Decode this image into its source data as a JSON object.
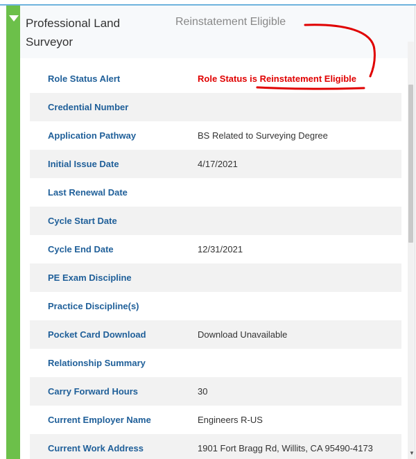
{
  "role": {
    "title": "Professional Land Surveyor",
    "status": "Reinstatement Eligible"
  },
  "rows": [
    {
      "label": "Role Status Alert",
      "value": "Role Status is Reinstatement Eligible"
    },
    {
      "label": "Credential Number",
      "value": ""
    },
    {
      "label": "Application Pathway",
      "value": "BS Related to Surveying Degree"
    },
    {
      "label": "Initial Issue Date",
      "value": "4/17/2021"
    },
    {
      "label": "Last Renewal Date",
      "value": ""
    },
    {
      "label": "Cycle Start Date",
      "value": ""
    },
    {
      "label": "Cycle End Date",
      "value": "12/31/2021"
    },
    {
      "label": "PE Exam Discipline",
      "value": ""
    },
    {
      "label": "Practice Discipline(s)",
      "value": ""
    },
    {
      "label": "Pocket Card Download",
      "value": "Download Unavailable"
    },
    {
      "label": "Relationship Summary",
      "value": ""
    },
    {
      "label": "Carry Forward Hours",
      "value": "30"
    },
    {
      "label": "Current Employer Name",
      "value": "Engineers R-US"
    },
    {
      "label": "Current Work Address",
      "value": "1901 Fort Bragg Rd, Willits, CA 95490-4173"
    }
  ],
  "colors": {
    "accent": "#6cc04a",
    "label": "#1f5f99",
    "alert": "#e00000",
    "annotation": "#e00000"
  },
  "icons": {
    "toggle": "caret-down-icon"
  }
}
